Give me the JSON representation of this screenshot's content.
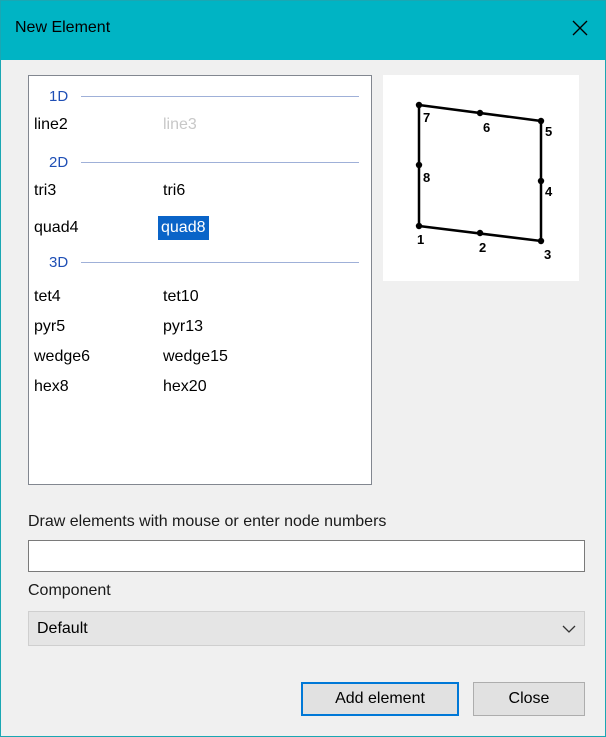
{
  "window": {
    "title": "New Element",
    "close_glyph": "✕",
    "title_bar_color": "#00b4c4"
  },
  "element_list": {
    "groups": [
      {
        "label": "1D",
        "items": [
          {
            "label": "line2",
            "state": "normal"
          },
          {
            "label": "line3",
            "state": "disabled"
          }
        ]
      },
      {
        "label": "2D",
        "items": [
          {
            "label": "tri3",
            "state": "normal"
          },
          {
            "label": "tri6",
            "state": "normal"
          },
          {
            "label": "quad4",
            "state": "normal"
          },
          {
            "label": "quad8",
            "state": "selected"
          }
        ]
      },
      {
        "label": "3D",
        "items": [
          {
            "label": "tet4",
            "state": "normal"
          },
          {
            "label": "tet10",
            "state": "normal"
          },
          {
            "label": "pyr5",
            "state": "normal"
          },
          {
            "label": "pyr13",
            "state": "normal"
          },
          {
            "label": "wedge6",
            "state": "normal"
          },
          {
            "label": "wedge15",
            "state": "normal"
          },
          {
            "label": "hex8",
            "state": "normal"
          },
          {
            "label": "hex20",
            "state": "normal"
          }
        ]
      }
    ],
    "selection_color": "#0a64c8"
  },
  "preview": {
    "element": "quad8",
    "node_labels": [
      "1",
      "2",
      "3",
      "4",
      "5",
      "6",
      "7",
      "8"
    ]
  },
  "node_entry": {
    "label": "Draw elements with mouse or enter node numbers",
    "value": "",
    "placeholder": ""
  },
  "component": {
    "label": "Component",
    "selected": "Default"
  },
  "buttons": {
    "add_label": "Add element",
    "close_label": "Close"
  }
}
